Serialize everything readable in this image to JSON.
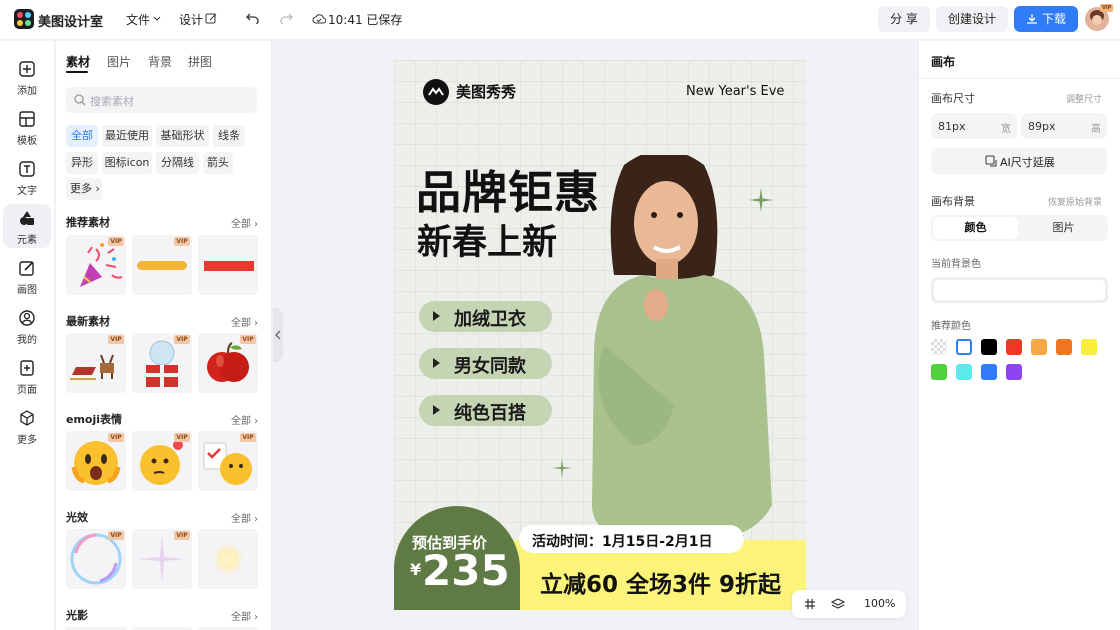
{
  "app": {
    "name": "美图设计室"
  },
  "toolbar": {
    "file_menu": "文件",
    "design_menu": "设计",
    "save_status": "10:41 已保存",
    "share_label": "分 享",
    "create_label": "创建设计",
    "download_label": "下载",
    "avatar_badge": "VIP",
    "accent_color": "#2f7cf6"
  },
  "rail": {
    "items": [
      {
        "label": "添加",
        "icon": "plus-square-icon"
      },
      {
        "label": "模板",
        "icon": "template-icon"
      },
      {
        "label": "文字",
        "icon": "text-icon"
      },
      {
        "label": "元素",
        "icon": "shapes-icon"
      },
      {
        "label": "画图",
        "icon": "pen-icon"
      },
      {
        "label": "我的",
        "icon": "user-icon"
      },
      {
        "label": "页面",
        "icon": "page-add-icon"
      },
      {
        "label": "更多",
        "icon": "cube-icon"
      }
    ],
    "active_index": 3
  },
  "panel": {
    "tabs": [
      "素材",
      "图片",
      "背景",
      "拼图"
    ],
    "search_placeholder": "搜索素材",
    "chips": [
      "全部",
      "最近使用",
      "基础形状",
      "线条",
      "异形",
      "图标icon",
      "分隔线",
      "箭头",
      "更多"
    ],
    "sections": [
      {
        "title": "推荐素材",
        "all": "全部"
      },
      {
        "title": "最新素材",
        "all": "全部"
      },
      {
        "title": "emoji表情",
        "all": "全部"
      },
      {
        "title": "光效",
        "all": "全部"
      },
      {
        "title": "光影",
        "all": "全部"
      }
    ],
    "vip_label": "VIP"
  },
  "poster": {
    "brand": "美图秀秀",
    "corner_text": "New Year's Eve",
    "headline1": "品牌钜惠",
    "headline2": "新春上新",
    "features": [
      "加绒卫衣",
      "男女同款",
      "纯色百搭"
    ],
    "price_label": "预估到手价",
    "price_currency": "¥",
    "price_value": "235",
    "event_time": "活动时间：1月15日-2月1日",
    "promo": "立减60 全场3件 9折起",
    "colors": {
      "green": "#5f7a45",
      "yellow": "#fbf37a",
      "pill": "#c5d5b4"
    }
  },
  "zoom": {
    "level": "100%"
  },
  "right_panel": {
    "title": "画布",
    "size_label": "画布尺寸",
    "size_adjust": "调整尺寸",
    "width_value": "81px",
    "width_unit": "宽",
    "height_value": "89px",
    "height_unit": "高",
    "ai_extend": "AI尺寸延展",
    "bg_label": "画布背景",
    "bg_reset": "恢复原始背景",
    "bg_tabs": [
      "颜色",
      "图片"
    ],
    "current_bg_label": "当前背景色",
    "recommended_label": "推荐颜色",
    "swatches": [
      "transparent",
      "#ffffff",
      "#000000",
      "#ee3a24",
      "#f5a742",
      "#f07722",
      "#f7ef3a",
      "#4ed13c",
      "#5de8ee",
      "#2f7cf6",
      "#8e44f1"
    ]
  }
}
